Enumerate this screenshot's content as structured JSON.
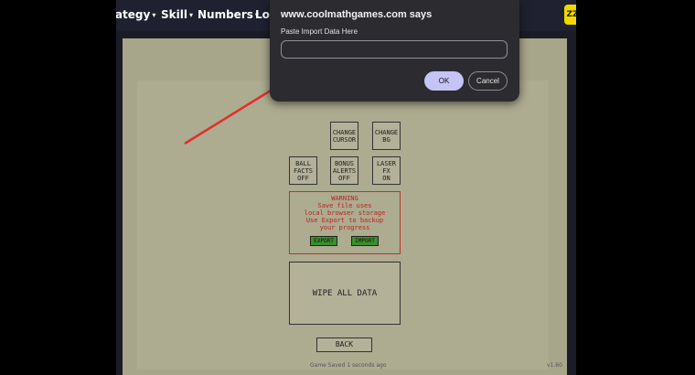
{
  "nav": {
    "items": [
      {
        "label": "rategy"
      },
      {
        "label": "Skill"
      },
      {
        "label": "Numbers"
      },
      {
        "label": "Lo"
      }
    ],
    "chevron": "▾",
    "badge": "ZZ"
  },
  "dialog": {
    "title": "www.coolmathgames.com says",
    "message": "Paste Import Data Here",
    "input_value": "",
    "input_placeholder": "",
    "ok_label": "OK",
    "cancel_label": "Cancel"
  },
  "game": {
    "buttons": {
      "change_cursor": "CHANGE\nCURSOR",
      "change_bg": "CHANGE\nBG",
      "ball_facts": "BALL\nFACTS\nOFF",
      "bonus_alerts": "BONUS\nALERTS\nOFF",
      "laser_fx": "LASER\nFX\nON",
      "wipe_all_data": "WIPE ALL DATA",
      "back": "BACK"
    },
    "warning": "WARNING\nSave file uses\nlocal browser storage\nUse Export to backup\nyour progress",
    "export_label": "EXPORT",
    "import_label": "IMPORT",
    "saved_status": "Game Saved 1 seconds ago",
    "version": "v1.60"
  },
  "colors": {
    "dialog_bg": "#2c2b30",
    "ok_button": "#c6c3f7",
    "arrow": "#e0302b",
    "game_bg": "#a8a68a"
  }
}
